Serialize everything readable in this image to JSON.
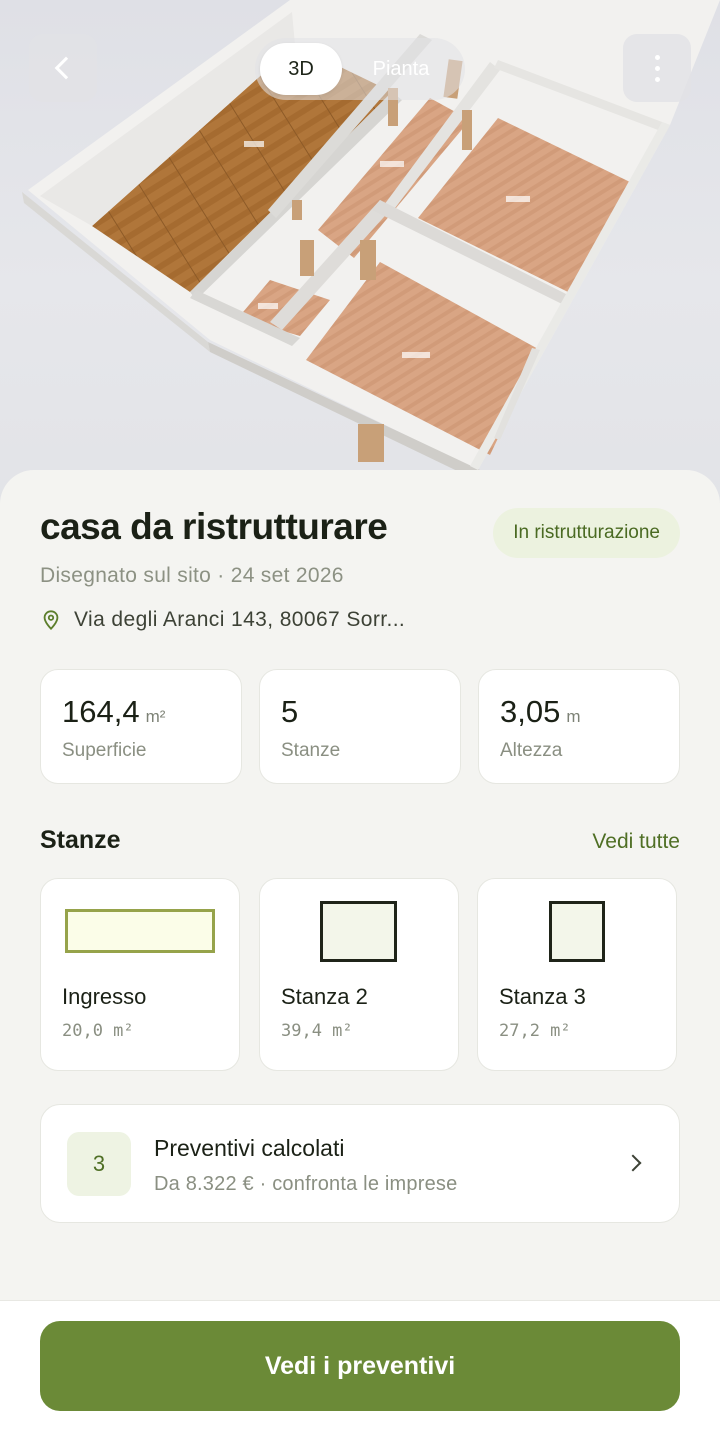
{
  "header": {
    "view_modes": [
      "3D",
      "Pianta"
    ],
    "active_view": "3D",
    "icons": {
      "back": "chevron-left-icon",
      "more": "more-vertical-icon"
    }
  },
  "project": {
    "title": "casa da ristrutturare",
    "status": "In ristrutturazione",
    "meta": "Disegnato sul sito · 24 set 2026",
    "address": "Via degli Aranci 143, 80067 Sorr..."
  },
  "stats": [
    {
      "value": "164,4",
      "unit": "m²",
      "label": "Superficie"
    },
    {
      "value": "5",
      "unit": "",
      "label": "Stanze"
    },
    {
      "value": "3,05",
      "unit": "m",
      "label": "Altezza"
    }
  ],
  "rooms_section": {
    "title": "Stanze",
    "see_all": "Vedi tutte",
    "rooms": [
      {
        "name": "Ingresso",
        "area": "20,0 m²"
      },
      {
        "name": "Stanza 2",
        "area": "39,4 m²"
      },
      {
        "name": "Stanza 3",
        "area": "27,2 m²"
      }
    ]
  },
  "quotes": {
    "count": "3",
    "title": "Preventivi calcolati",
    "subtitle": "Da 8.322 € · confronta le imprese"
  },
  "cta": {
    "label": "Vedi i preventivi"
  },
  "colors": {
    "accent": "#6b8a37",
    "accent_text": "#4f6f25",
    "badge_bg": "#ecf2df",
    "sheet_bg": "#f4f4f1"
  }
}
